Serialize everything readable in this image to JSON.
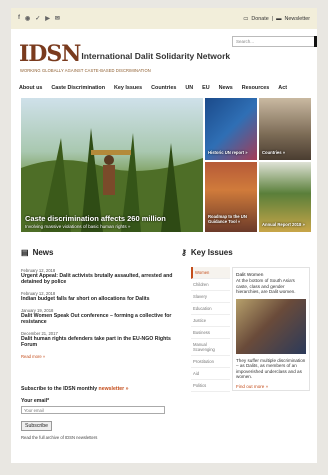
{
  "topbar": {
    "social_icons": [
      "facebook-icon",
      "rss-icon",
      "twitter-icon",
      "youtube-icon",
      "mail-icon"
    ],
    "donate_label": "Donate",
    "newsletter_label": "Newsletter"
  },
  "header": {
    "logo_letters": "IDSN",
    "org_name": "International Dalit Solidarity Network",
    "tagline": "WORKING GLOBALLY AGAINST CASTE-BASED DISCRIMINATION",
    "search_placeholder": "Search..."
  },
  "nav": {
    "items": [
      "About us",
      "Caste Discrimination",
      "Key Issues",
      "Countries",
      "UN",
      "EU",
      "News",
      "Resources",
      "Act"
    ]
  },
  "hero": {
    "main_caption_title": "Caste discrimination affects 260 million",
    "main_caption_sub": "Involving massive violations of basic human rights »",
    "tiles": [
      "Historic UN report »",
      "Countries »",
      "Roadmap to the UN Guidance Tool »",
      "Annual Report 2018 »"
    ]
  },
  "news": {
    "title": "News",
    "items": [
      {
        "date": "February 12, 2018",
        "title": "Urgent Appeal: Dalit activists brutally assaulted, arrested and detained by police"
      },
      {
        "date": "February 12, 2018",
        "title": "Indian budget falls far short on allocations for Dalits"
      },
      {
        "date": "January 19, 2018",
        "title": "Dalit Women Speak Out conference – forming a collective for resistance"
      },
      {
        "date": "December 21, 2017",
        "title": "Dalit human rights defenders take part in the EU-NGO Rights Forum"
      }
    ],
    "read_more": "Read more »"
  },
  "subscribe": {
    "heading_prefix": "Subscribe to the IDSN monthly ",
    "heading_link": "newsletter »",
    "email_label": "Your email*",
    "email_placeholder": "Your email",
    "button": "Subscribe",
    "footer_text": "Read the full archive of IDSN newsletters"
  },
  "key_issues": {
    "title": "Key Issues",
    "items": [
      "Women",
      "Children",
      "Slavery",
      "Education",
      "Justice",
      "Business",
      "Manual Scavenging",
      "Prostitution",
      "Aid",
      "Politics"
    ],
    "active_index": 0,
    "panel_title": "Dalit Women",
    "panel_intro": "At the bottom of South Asia's caste, class and gender hierarchies, are Dalit women.",
    "panel_body": "They suffer multiple discrimination – as Dalits, as members of an impoverished underclass and as women.",
    "panel_link": "Find out more »"
  },
  "colors": {
    "accent": "#c44d1b",
    "logo": "#7a3b1e",
    "topbar": "#f2eeda"
  }
}
